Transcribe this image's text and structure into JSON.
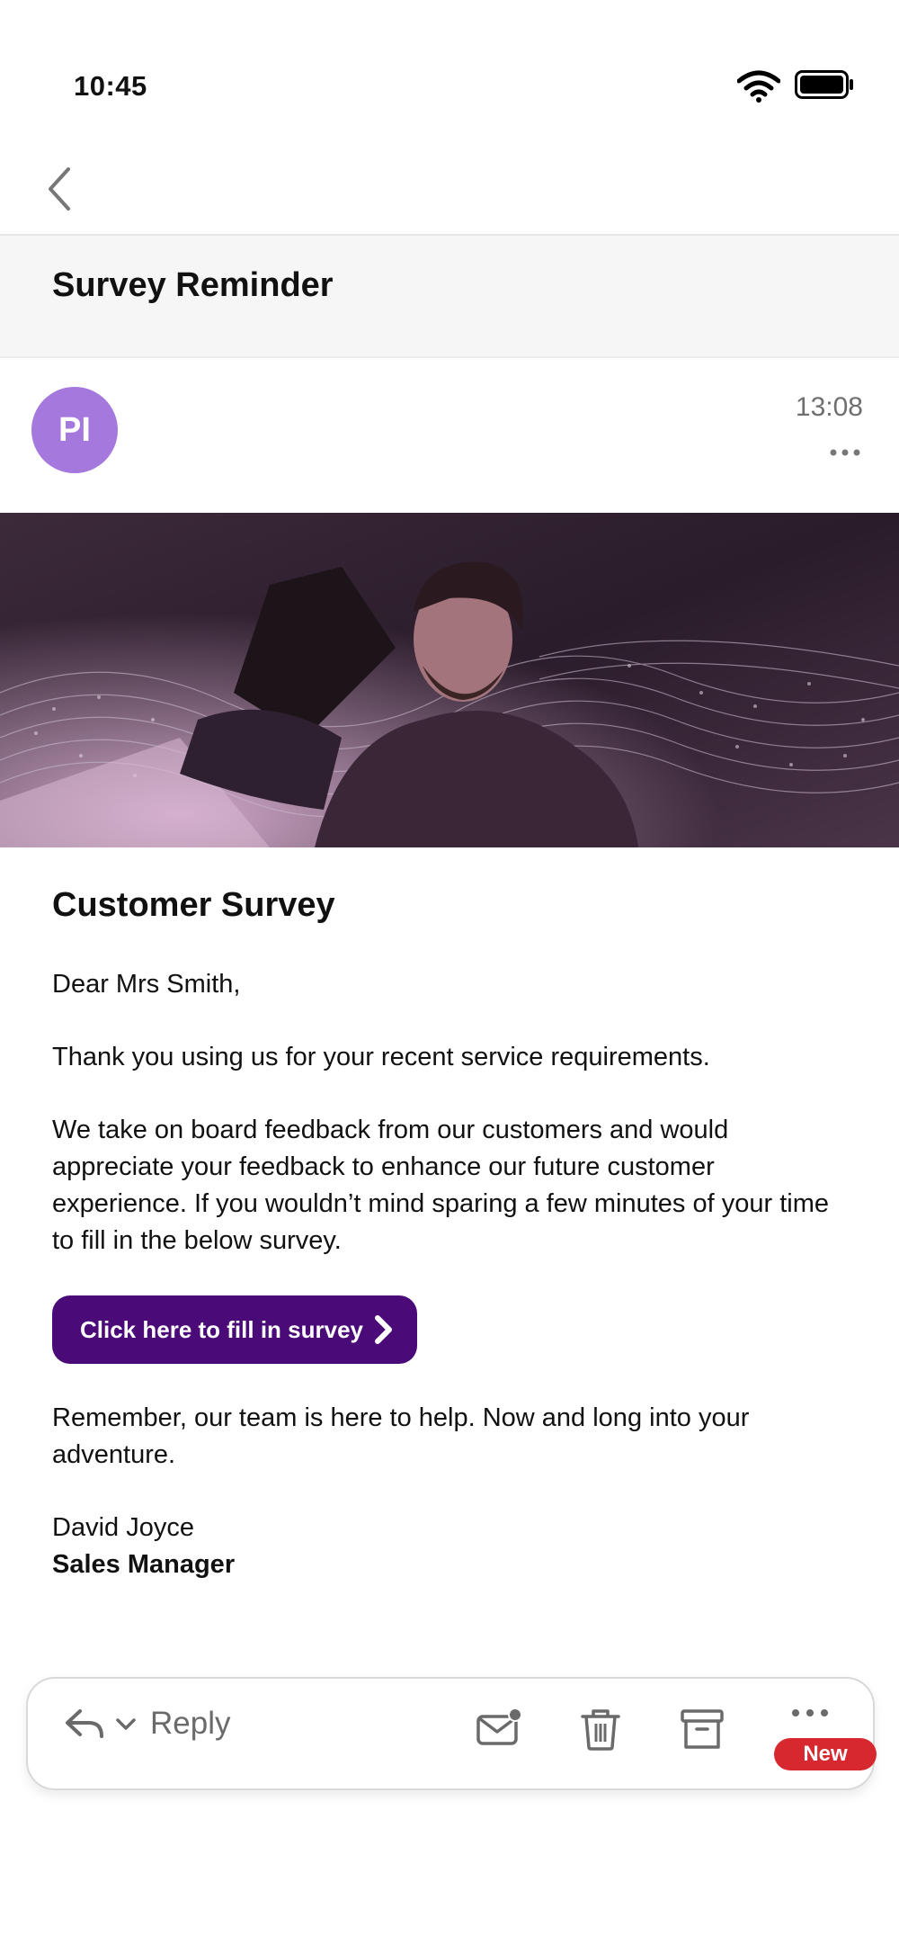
{
  "status_bar": {
    "time": "10:45"
  },
  "email": {
    "subject": "Survey Reminder",
    "sender_initials": "PI",
    "received_time": "13:08"
  },
  "body": {
    "title": "Customer Survey",
    "greeting": "Dear Mrs Smith,",
    "paragraph1": "Thank you using us for your recent service requirements.",
    "paragraph2": "We take on board feedback from our customers and would appreciate your feedback to enhance our future customer experience. If you wouldn’t mind sparing a few minutes of your time to fill in the below survey.",
    "cta_label": "Click here to fill in survey",
    "paragraph3": "Remember, our team is here to help. Now and long into your adventure.",
    "signature_name": "David Joyce",
    "signature_title": "Sales Manager"
  },
  "toolbar": {
    "reply_label": "Reply",
    "new_badge": "New"
  },
  "colors": {
    "avatar": "#a578de",
    "cta_background": "#4a0a78",
    "badge": "#d7282f"
  }
}
